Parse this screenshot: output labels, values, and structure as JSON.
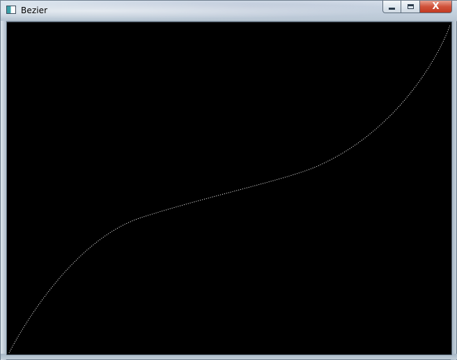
{
  "window": {
    "title": "Bezier",
    "icon": "app-window-icon",
    "controls": {
      "minimize_icon": "minimize-icon",
      "maximize_icon": "maximize-icon",
      "close_icon": "close-icon",
      "close_glyph": "X"
    }
  },
  "colors": {
    "canvas_background": "#000000",
    "curve": "#ffffff",
    "close_button": "#c23a22"
  }
}
